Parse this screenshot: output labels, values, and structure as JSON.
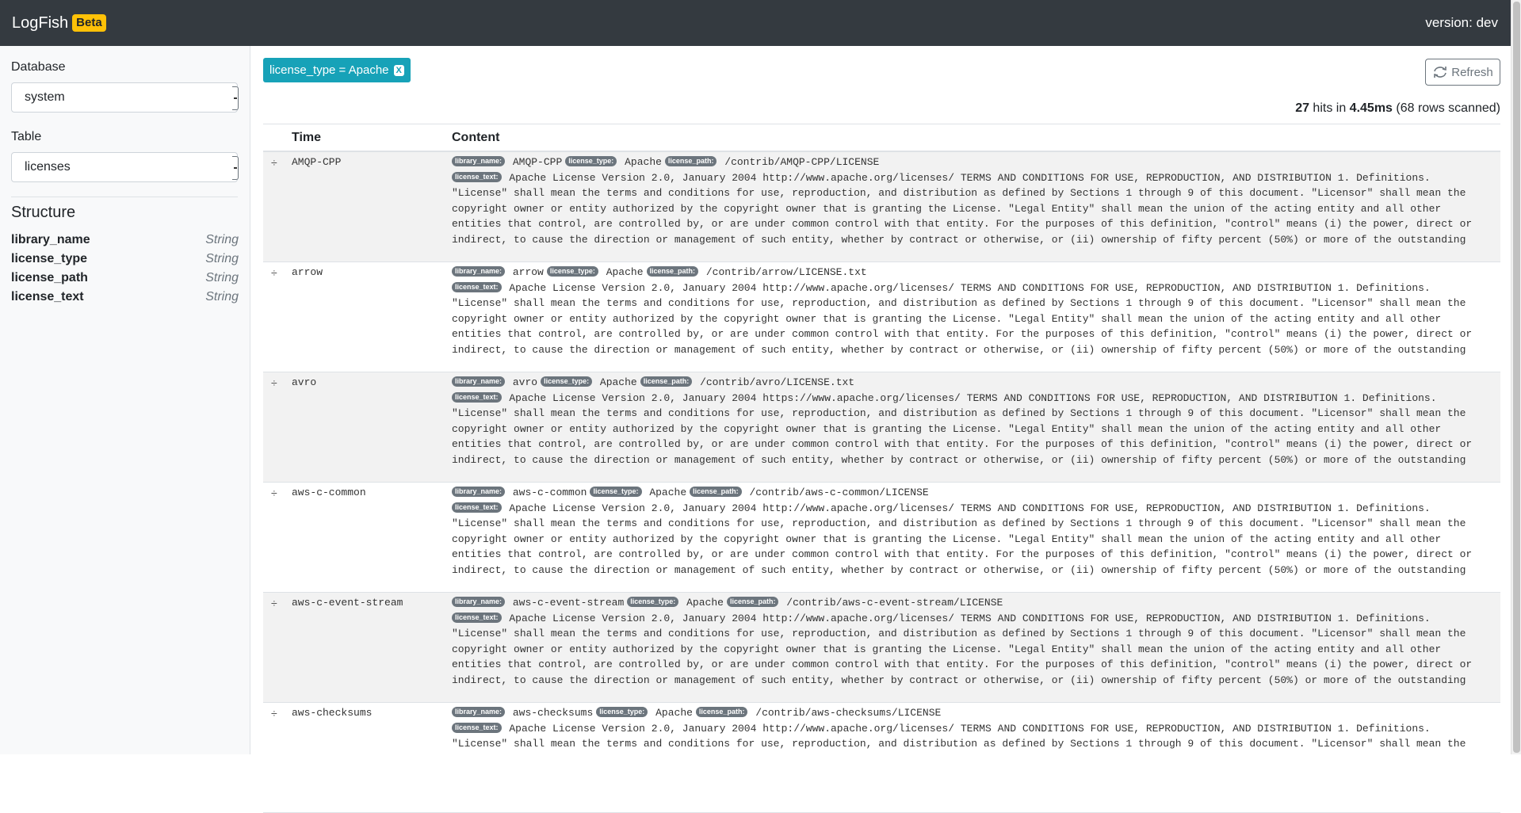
{
  "header": {
    "brand": "LogFish",
    "badge": "Beta",
    "version": "version: dev"
  },
  "sidebar": {
    "database_label": "Database",
    "database_value": "system",
    "table_label": "Table",
    "table_value": "licenses",
    "structure_title": "Structure",
    "fields": [
      {
        "name": "library_name",
        "type": "String"
      },
      {
        "name": "license_type",
        "type": "String"
      },
      {
        "name": "license_path",
        "type": "String"
      },
      {
        "name": "license_text",
        "type": "String"
      }
    ]
  },
  "main": {
    "filter_chip": "license_type = Apache",
    "filter_remove": "X",
    "refresh_label": "Refresh",
    "hits_count": "27",
    "hits_word": " hits in ",
    "hits_time": "4.45ms",
    "hits_scanned": " (68 rows scanned)",
    "columns": {
      "time": "Time",
      "content": "Content"
    },
    "tag_labels": {
      "library_name": "library_name:",
      "license_type": "license_type:",
      "license_path": "license_path:",
      "license_text": "license_text:"
    },
    "rows": [
      {
        "time": "AMQP-CPP",
        "library_name": "AMQP-CPP",
        "license_type": "Apache",
        "license_path": "/contrib/AMQP-CPP/LICENSE",
        "license_text": "Apache License Version 2.0, January 2004 http://www.apache.org/licenses/ TERMS AND CONDITIONS FOR USE, REPRODUCTION, AND DISTRIBUTION 1. Definitions. \"License\" shall mean the terms and conditions for use, reproduction, and distribution as defined by Sections 1 through 9 of this document. \"Licensor\" shall mean the copyright owner or entity authorized by the copyright owner that is granting the License. \"Legal Entity\" shall mean the union of the acting entity and all other entities that control, are controlled by, or are under common control with that entity. For the purposes of this definition, \"control\" means (i) the power, direct or indirect, to cause the direction or management of such entity, whether by contract or otherwise, or (ii) ownership of fifty percent (50%) or more of the outstanding"
      },
      {
        "time": "arrow",
        "library_name": "arrow",
        "license_type": "Apache",
        "license_path": "/contrib/arrow/LICENSE.txt",
        "license_text": "Apache License Version 2.0, January 2004 http://www.apache.org/licenses/ TERMS AND CONDITIONS FOR USE, REPRODUCTION, AND DISTRIBUTION 1. Definitions. \"License\" shall mean the terms and conditions for use, reproduction, and distribution as defined by Sections 1 through 9 of this document. \"Licensor\" shall mean the copyright owner or entity authorized by the copyright owner that is granting the License. \"Legal Entity\" shall mean the union of the acting entity and all other entities that control, are controlled by, or are under common control with that entity. For the purposes of this definition, \"control\" means (i) the power, direct or indirect, to cause the direction or management of such entity, whether by contract or otherwise, or (ii) ownership of fifty percent (50%) or more of the outstanding"
      },
      {
        "time": "avro",
        "library_name": "avro",
        "license_type": "Apache",
        "license_path": "/contrib/avro/LICENSE.txt",
        "license_text": "Apache License Version 2.0, January 2004 https://www.apache.org/licenses/ TERMS AND CONDITIONS FOR USE, REPRODUCTION, AND DISTRIBUTION 1. Definitions. \"License\" shall mean the terms and conditions for use, reproduction, and distribution as defined by Sections 1 through 9 of this document. \"Licensor\" shall mean the copyright owner or entity authorized by the copyright owner that is granting the License. \"Legal Entity\" shall mean the union of the acting entity and all other entities that control, are controlled by, or are under common control with that entity. For the purposes of this definition, \"control\" means (i) the power, direct or indirect, to cause the direction or management of such entity, whether by contract or otherwise, or (ii) ownership of fifty percent (50%) or more of the outstanding"
      },
      {
        "time": "aws-c-common",
        "library_name": "aws-c-common",
        "license_type": "Apache",
        "license_path": "/contrib/aws-c-common/LICENSE",
        "license_text": "Apache License Version 2.0, January 2004 http://www.apache.org/licenses/ TERMS AND CONDITIONS FOR USE, REPRODUCTION, AND DISTRIBUTION 1. Definitions. \"License\" shall mean the terms and conditions for use, reproduction, and distribution as defined by Sections 1 through 9 of this document. \"Licensor\" shall mean the copyright owner or entity authorized by the copyright owner that is granting the License. \"Legal Entity\" shall mean the union of the acting entity and all other entities that control, are controlled by, or are under common control with that entity. For the purposes of this definition, \"control\" means (i) the power, direct or indirect, to cause the direction or management of such entity, whether by contract or otherwise, or (ii) ownership of fifty percent (50%) or more of the outstanding"
      },
      {
        "time": "aws-c-event-stream",
        "library_name": "aws-c-event-stream",
        "license_type": "Apache",
        "license_path": "/contrib/aws-c-event-stream/LICENSE",
        "license_text": "Apache License Version 2.0, January 2004 http://www.apache.org/licenses/ TERMS AND CONDITIONS FOR USE, REPRODUCTION, AND DISTRIBUTION 1. Definitions. \"License\" shall mean the terms and conditions for use, reproduction, and distribution as defined by Sections 1 through 9 of this document. \"Licensor\" shall mean the copyright owner or entity authorized by the copyright owner that is granting the License. \"Legal Entity\" shall mean the union of the acting entity and all other entities that control, are controlled by, or are under common control with that entity. For the purposes of this definition, \"control\" means (i) the power, direct or indirect, to cause the direction or management of such entity, whether by contract or otherwise, or (ii) ownership of fifty percent (50%) or more of the outstanding"
      },
      {
        "time": "aws-checksums",
        "library_name": "aws-checksums",
        "license_type": "Apache",
        "license_path": "/contrib/aws-checksums/LICENSE",
        "license_text": "Apache License Version 2.0, January 2004 http://www.apache.org/licenses/ TERMS AND CONDITIONS FOR USE, REPRODUCTION, AND DISTRIBUTION 1. Definitions. \"License\" shall mean the terms and conditions for use, reproduction, and distribution as defined by Sections 1 through 9 of this document. \"Licensor\" shall mean the"
      }
    ]
  },
  "colors": {
    "navbar": "#343a40",
    "badge": "#ffc107",
    "filter_chip": "#17a2b8",
    "tag": "#6c757d",
    "row_alt": "#f2f2f2"
  }
}
